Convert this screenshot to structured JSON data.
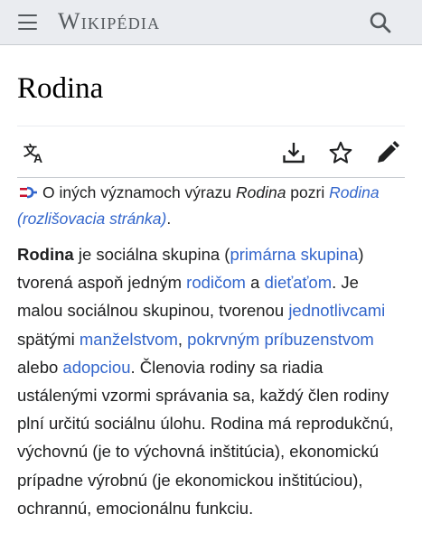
{
  "header": {
    "logo_text": "Wikipédia",
    "menu_icon": "hamburger-menu-icon",
    "search_icon": "search-icon"
  },
  "page": {
    "title": "Rodina"
  },
  "toolbar": {
    "language_icon": "language-icon",
    "download_icon": "download-icon",
    "watch_icon": "star-icon",
    "edit_icon": "pencil-icon"
  },
  "hatnote": {
    "icon": "disambiguation-icon",
    "text_before": "O iných významoch výrazu ",
    "term": "Rodina",
    "text_middle": " pozri ",
    "link": "Rodina (rozlišovacia stránka)",
    "text_after": "."
  },
  "paragraph": {
    "bold_term": "Rodina",
    "t1": " je sociálna skupina (",
    "l1": "primárna skupina",
    "t2": ") tvorená aspoň jedným ",
    "l2": "rodičom",
    "t3": " a ",
    "l3": "dieťaťom",
    "t4": ". Je malou sociálnou skupinou, tvorenou ",
    "l4": "jednotlivcami",
    "t5": " spätými ",
    "l5": "manželstvom",
    "t6": ", ",
    "l6": "pokrvným príbuzenstvom",
    "t7": " alebo ",
    "l7": "adopciou",
    "t8": ". Členovia rodiny sa riadia ustálenými vzormi správania sa, každý člen rodiny plní určitú sociálnu úlohu. Rodina má reprodukčnú, výchovnú (je to výchovná inštitúcia), ekonomickú prípadne výrobnú (je ekonomickou inštitúciou), ochrannú, emocionálnu funkciu."
  },
  "colors": {
    "link": "#3366cc",
    "text": "#202122",
    "header_bg": "#eaecf0",
    "icon": "#54595d"
  }
}
